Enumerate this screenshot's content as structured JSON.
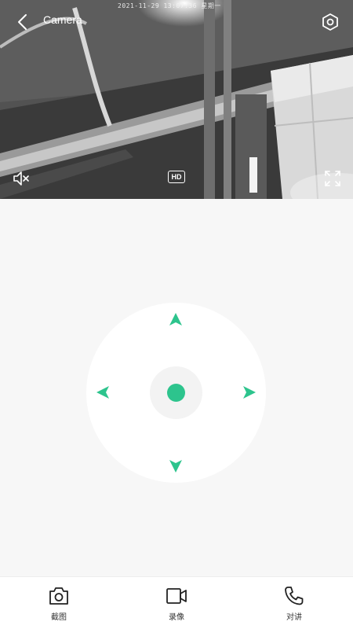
{
  "header": {
    "title": "Camera",
    "timestamp": "2021-11-29 13:07:36 星期一"
  },
  "video": {
    "quality_label": "HD"
  },
  "ptz": {
    "accent_color": "#2dc48d"
  },
  "toolbar": {
    "items": [
      {
        "label": "截图",
        "icon": "camera-icon"
      },
      {
        "label": "录像",
        "icon": "video-icon"
      },
      {
        "label": "对讲",
        "icon": "phone-icon"
      }
    ]
  }
}
